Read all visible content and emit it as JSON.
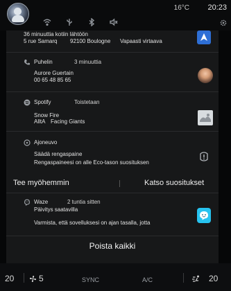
{
  "status_bar": {
    "temperature": "16°C",
    "time": "20:23",
    "icons": [
      "wifi-icon",
      "usb-icon",
      "bluetooth-icon",
      "volume-mute-icon"
    ]
  },
  "notifications": {
    "nav": {
      "line1": "36 minuuttia kotiin lähtöön",
      "address": "5 rue Samarq",
      "city": "92100 Boulogne",
      "traffic": "Vapaasti virtaava"
    },
    "phone": {
      "app": "Puhelin",
      "time_ago": "3 minuuttia",
      "contact_name": "Aurore Guertain",
      "contact_number": "00 65 48 85 65"
    },
    "spotify": {
      "app": "Spotify",
      "status": "Toistetaan",
      "track": "Snow Fire",
      "artist": "AlltA",
      "album": "Facing Giants"
    },
    "vehicle": {
      "app": "Ajoneuvo",
      "title": "Säädä rengaspaine",
      "body": "Rengaspaineesi on alle Eco-tason suosituksen",
      "later_button": "Tee myöhemmin",
      "recommend_button": "Katso suositukset"
    },
    "waze": {
      "app": "Waze",
      "time_ago": "2 tuntia sitten",
      "title": "Päivitys saatavilla",
      "body": "Varmista, että sovelluksesi on ajan tasalla, jotta"
    },
    "clear_all": "Poista kaikki"
  },
  "bottom_bar": {
    "left_temp": "20",
    "fan_speed": "5",
    "sync": "SYNC",
    "ac": "A/C",
    "right_temp": "20"
  },
  "colors": {
    "background": "#060708",
    "panel": "#171819",
    "nav_accent": "#2e6fd6",
    "waze_accent": "#27c3f0"
  }
}
